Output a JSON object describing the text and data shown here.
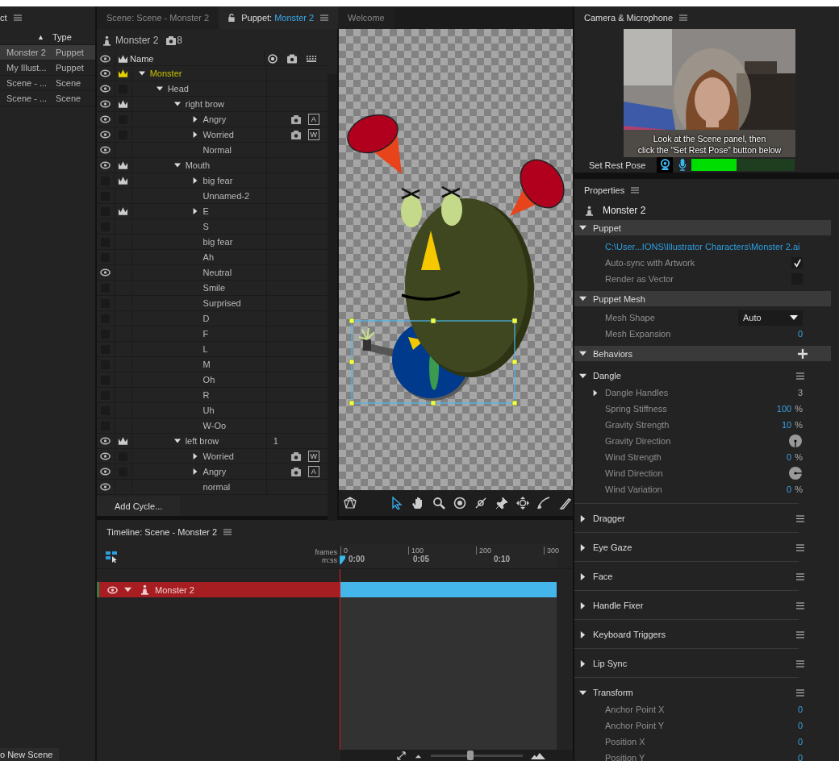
{
  "project_panel": {
    "title": "ct",
    "sort_indicator": "▲",
    "type_heading": "Type",
    "items": [
      {
        "name": "Monster 2",
        "type": "Puppet",
        "selected": true
      },
      {
        "name": "My Illust...",
        "type": "Puppet",
        "selected": false
      },
      {
        "name": "Scene - ...",
        "type": "Scene",
        "selected": false
      },
      {
        "name": "Scene - ...",
        "type": "Scene",
        "selected": false
      }
    ],
    "footer_button": "o New Scene"
  },
  "tabs": [
    {
      "prefix": "Scene:",
      "name": "Scene - Monster 2",
      "locked": false,
      "selected": false
    },
    {
      "prefix": "Puppet:",
      "name": "Monster 2",
      "locked": true,
      "selected": true
    },
    {
      "name": "Welcome",
      "locked": false,
      "selected": false
    }
  ],
  "puppet_panel": {
    "name": "Monster 2",
    "camera_count": "8",
    "name_heading": "Name",
    "add_cycle_button": "Add Cycle...",
    "layers": [
      {
        "name": "Monster",
        "visible": true,
        "kind": "crown",
        "selected": true,
        "expanded": true,
        "children": [
          {
            "name": "Head",
            "visible": true,
            "kind": "box",
            "selected": false,
            "expanded": true,
            "children": [
              {
                "name": "right brow",
                "visible": true,
                "kind": "crown",
                "selected": false,
                "expanded": true,
                "children": [
                  {
                    "name": "Angry",
                    "visible": true,
                    "kind": "box",
                    "selected": false,
                    "expanded": false,
                    "trigger": "A"
                  },
                  {
                    "name": "Worried",
                    "visible": true,
                    "kind": "box",
                    "selected": false,
                    "expanded": false,
                    "trigger": "W"
                  },
                  {
                    "name": "Normal",
                    "visible": true,
                    "selected": false
                  }
                ]
              },
              {
                "name": "Mouth",
                "visible": true,
                "kind": "crown",
                "selected": false,
                "expanded": true,
                "children": [
                  {
                    "name": "big fear",
                    "visible": false,
                    "kind": "crown",
                    "selected": false,
                    "expanded": false
                  },
                  {
                    "name": "Unnamed-2",
                    "visible": false,
                    "selected": false
                  },
                  {
                    "name": "E",
                    "visible": false,
                    "kind": "crown",
                    "selected": false,
                    "expanded": false
                  },
                  {
                    "name": "S",
                    "visible": false,
                    "selected": false
                  },
                  {
                    "name": "big fear",
                    "visible": false,
                    "selected": false
                  },
                  {
                    "name": "Ah",
                    "visible": false,
                    "selected": false
                  },
                  {
                    "name": "Neutral",
                    "visible": true,
                    "selected": false
                  },
                  {
                    "name": "Smile",
                    "visible": false,
                    "selected": false
                  },
                  {
                    "name": "Surprised",
                    "visible": false,
                    "selected": false
                  },
                  {
                    "name": "D",
                    "visible": false,
                    "selected": false
                  },
                  {
                    "name": "F",
                    "visible": false,
                    "selected": false
                  },
                  {
                    "name": "L",
                    "visible": false,
                    "selected": false
                  },
                  {
                    "name": "M",
                    "visible": false,
                    "selected": false
                  },
                  {
                    "name": "Oh",
                    "visible": false,
                    "selected": false
                  },
                  {
                    "name": "R",
                    "visible": false,
                    "selected": false
                  },
                  {
                    "name": "Uh",
                    "visible": false,
                    "selected": false
                  },
                  {
                    "name": "W-Oo",
                    "visible": false,
                    "selected": false
                  }
                ]
              },
              {
                "name": "left brow",
                "visible": true,
                "kind": "crown",
                "selected": false,
                "expanded": true,
                "value": "1",
                "children": [
                  {
                    "name": "Worried",
                    "visible": true,
                    "kind": "box",
                    "selected": false,
                    "expanded": false,
                    "trigger": "W"
                  },
                  {
                    "name": "Angry",
                    "visible": true,
                    "kind": "box",
                    "selected": false,
                    "expanded": false,
                    "trigger": "A"
                  },
                  {
                    "name": "normal",
                    "visible": true,
                    "selected": false
                  }
                ]
              }
            ]
          }
        ]
      }
    ]
  },
  "canvas_tools": [
    {
      "kind": "mesh",
      "selected": false
    },
    {
      "kind": "pointer",
      "selected": true
    },
    {
      "kind": "hand",
      "selected": false
    },
    {
      "kind": "zoom",
      "selected": false
    },
    {
      "kind": "origin",
      "selected": false
    },
    {
      "kind": "stick",
      "selected": false
    },
    {
      "kind": "pin",
      "selected": false
    },
    {
      "kind": "move",
      "selected": false
    },
    {
      "kind": "curve",
      "selected": false
    },
    {
      "kind": "knife",
      "selected": false
    }
  ],
  "camera": {
    "title": "Camera & Microphone",
    "overlay_text": "Look at the Scene panel, then\nclick the “Set Rest Pose” button below",
    "set_rest_pose_button": "Set Rest Pose",
    "camera_on": true,
    "level": 0.44
  },
  "properties": {
    "title": "Properties",
    "name": "Monster 2",
    "sections": [
      {
        "title": "Puppet",
        "expanded": true,
        "rows": [
          {
            "kind": "link",
            "text": "C:\\User...IONS\\Illustrator Characters\\Monster 2.ai"
          },
          {
            "kind": "checkbox",
            "label": "Auto-sync with Artwork",
            "checked": true
          },
          {
            "kind": "checkbox",
            "label": "Render as Vector",
            "checked": false
          }
        ]
      },
      {
        "title": "Puppet Mesh",
        "expanded": true,
        "rows": [
          {
            "kind": "dropdown",
            "label": "Mesh Shape",
            "value": "Auto"
          },
          {
            "kind": "number",
            "label": "Mesh Expansion",
            "value": "0"
          }
        ]
      }
    ],
    "behaviors_header": {
      "title": "Behaviors",
      "expanded": true
    },
    "behaviors": [
      {
        "title": "Dangle",
        "expanded": true,
        "rows": [
          {
            "kind": "expander",
            "label": "Dangle Handles",
            "value": "3",
            "expanded": false
          },
          {
            "kind": "number",
            "label": "Spring Stiffness",
            "value": "100",
            "unit": "%"
          },
          {
            "kind": "number",
            "label": "Gravity Strength",
            "value": "10",
            "unit": "%"
          },
          {
            "kind": "dial_down",
            "label": "Gravity Direction"
          },
          {
            "kind": "number",
            "label": "Wind Strength",
            "value": "0",
            "unit": "%"
          },
          {
            "kind": "dial_right",
            "label": "Wind Direction"
          },
          {
            "kind": "number",
            "label": "Wind Variation",
            "value": "0",
            "unit": "%"
          }
        ]
      },
      {
        "title": "Dragger",
        "expanded": false
      },
      {
        "title": "Eye Gaze",
        "expanded": false
      },
      {
        "title": "Face",
        "expanded": false
      },
      {
        "title": "Handle Fixer",
        "expanded": false
      },
      {
        "title": "Keyboard Triggers",
        "expanded": false
      },
      {
        "title": "Lip Sync",
        "expanded": false
      },
      {
        "title": "Transform",
        "expanded": true,
        "rows": [
          {
            "kind": "number",
            "label": "Anchor Point X",
            "value": "0"
          },
          {
            "kind": "number",
            "label": "Anchor Point Y",
            "value": "0"
          },
          {
            "kind": "number",
            "label": "Position X",
            "value": "0"
          },
          {
            "kind": "number",
            "label": "Position Y",
            "value": "0"
          }
        ]
      }
    ]
  },
  "timeline": {
    "title": "Timeline: Scene - Monster 2",
    "frames_label": "frames",
    "time_label": "m:ss",
    "frame_ticks": [
      "0",
      "100",
      "200",
      "300"
    ],
    "time_ticks": [
      "0:00",
      "0:05",
      "0:10"
    ],
    "tracks": [
      {
        "name": "Monster 2",
        "visible": true,
        "expanded": true,
        "selected": true
      }
    ],
    "zoom": {
      "level": 0.43
    }
  }
}
